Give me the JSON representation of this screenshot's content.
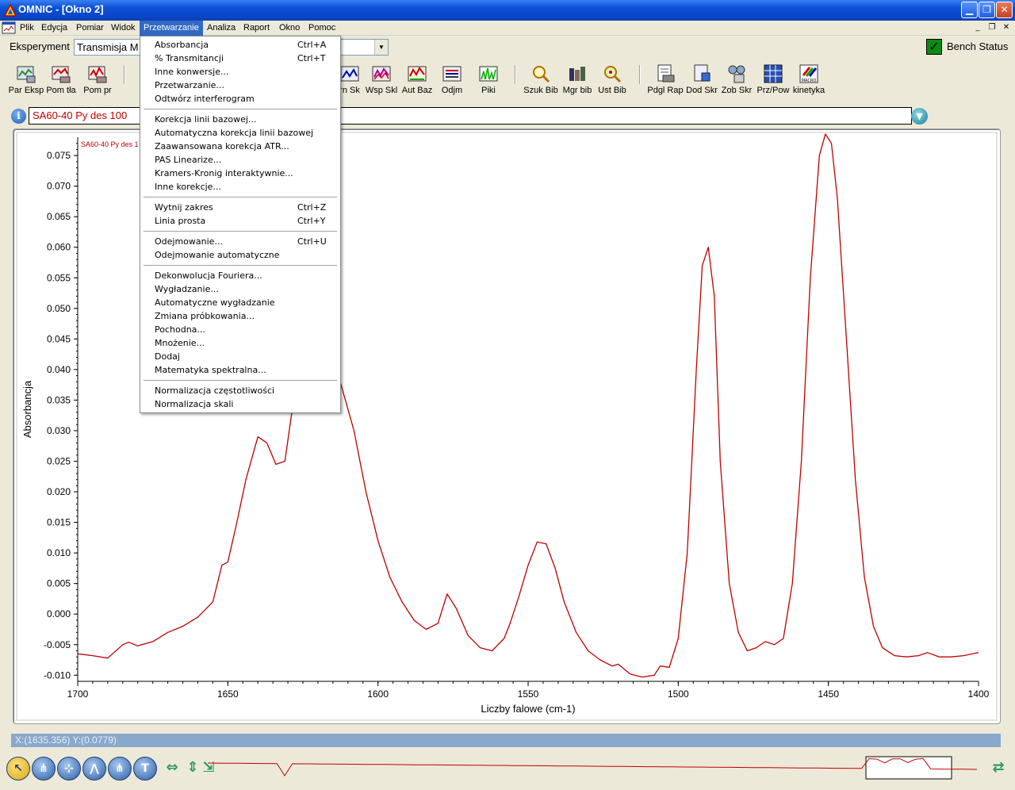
{
  "window": {
    "title": "OMNIC - [Okno 2]"
  },
  "menubar": {
    "items": [
      "Plik",
      "Edycja",
      "Pomiar",
      "Widok",
      "Przetwarzanie",
      "Analiza",
      "Raport",
      "Okno",
      "Pomoc"
    ],
    "active": "Przetwarzanie"
  },
  "experiment": {
    "label": "Eksperyment",
    "value": "Transmisja M"
  },
  "bench_status": {
    "label": "Bench Status"
  },
  "toolbar": {
    "items": [
      "Par Eksp",
      "Pom tła",
      "Pom pr",
      "rn Sk",
      "Wsp Skl",
      "Aut Baz",
      "Odjm",
      "Piki",
      "Szuk Bib",
      "Mgr bib",
      "Ust Bib",
      "Pdgl Rap",
      "Dod Skr",
      "Zob Skr",
      "Prz/Pow",
      "kinetyka"
    ],
    "macro_label": "MACRO"
  },
  "spectrum": {
    "title": "SA60-40 Py des 100",
    "inset_label": "SA60-40 Py des 1"
  },
  "dropdown": {
    "items": [
      {
        "label": "Absorbancja",
        "shortcut": "Ctrl+A"
      },
      {
        "label": "% Transmitancji",
        "shortcut": "Ctrl+T"
      },
      {
        "label": "Inne konwersje...",
        "shortcut": ""
      },
      {
        "label": "Przetwarzanie...",
        "shortcut": ""
      },
      {
        "label": "Odtwórz interferogram",
        "shortcut": ""
      },
      {
        "label": "Korekcja linii bazowej...",
        "shortcut": ""
      },
      {
        "label": "Automatyczna korekcja linii bazowej",
        "shortcut": ""
      },
      {
        "label": "Zaawansowana korekcja ATR...",
        "shortcut": ""
      },
      {
        "label": "PAS Linearize...",
        "shortcut": ""
      },
      {
        "label": "Kramers-Kronig interaktywnie...",
        "shortcut": ""
      },
      {
        "label": "Inne korekcje...",
        "shortcut": ""
      },
      {
        "label": "Wytnij zakres",
        "shortcut": "Ctrl+Z"
      },
      {
        "label": "Linia prosta",
        "shortcut": "Ctrl+Y"
      },
      {
        "label": "Odejmowanie...",
        "shortcut": "Ctrl+U"
      },
      {
        "label": "Odejmowanie automatyczne",
        "shortcut": ""
      },
      {
        "label": "Dekonwolucja Fouriera...",
        "shortcut": ""
      },
      {
        "label": "Wygładzanie...",
        "shortcut": ""
      },
      {
        "label": "Automatyczne wygładzanie",
        "shortcut": ""
      },
      {
        "label": "Zmiana próbkowania...",
        "shortcut": ""
      },
      {
        "label": "Pochodna...",
        "shortcut": ""
      },
      {
        "label": "Mnożenie...",
        "shortcut": ""
      },
      {
        "label": "Dodaj",
        "shortcut": ""
      },
      {
        "label": "Matematyka spektralna...",
        "shortcut": ""
      },
      {
        "label": "Normalizacja częstotliwości",
        "shortcut": ""
      },
      {
        "label": "Normalizacja skali",
        "shortcut": ""
      }
    ]
  },
  "status": {
    "coords": "X:(1635.356) Y:(0.0779)"
  },
  "chart_data": {
    "type": "line",
    "xlabel": "Liczby falowe (cm-1)",
    "ylabel": "Absorbancja",
    "xlim": [
      1700,
      1400
    ],
    "ylim": [
      -0.011,
      0.078
    ],
    "x_ticks": [
      "1700",
      "1650",
      "1600",
      "1550",
      "1500",
      "1450",
      "1400"
    ],
    "y_ticks": [
      "0.075",
      "0.070",
      "0.065",
      "0.060",
      "0.055",
      "0.050",
      "0.045",
      "0.040",
      "0.035",
      "0.030",
      "0.025",
      "0.020",
      "0.015",
      "0.010",
      "0.005",
      "0.000",
      "-0.005",
      "-0.010"
    ],
    "series": [
      {
        "color": "#c00000",
        "x": [
          1700,
          1695,
          1690,
          1685,
          1683,
          1680,
          1675,
          1670,
          1665,
          1660,
          1655,
          1652,
          1650,
          1647,
          1644,
          1640,
          1637,
          1634,
          1631,
          1629,
          1627,
          1625,
          1622,
          1618,
          1615,
          1612,
          1608,
          1604,
          1600,
          1596,
          1592,
          1588,
          1584,
          1580,
          1577,
          1574,
          1570,
          1566,
          1562,
          1558,
          1556,
          1553,
          1550,
          1547,
          1544,
          1541,
          1538,
          1534,
          1530,
          1526,
          1522,
          1520,
          1516,
          1512,
          1508,
          1506,
          1503,
          1500,
          1497,
          1494,
          1492,
          1490,
          1488,
          1486,
          1483,
          1480,
          1477,
          1474,
          1471,
          1468,
          1465,
          1462,
          1459,
          1456,
          1453,
          1451,
          1449,
          1447,
          1444,
          1441,
          1438,
          1435,
          1432,
          1428,
          1424,
          1420,
          1417,
          1413,
          1409,
          1405,
          1400
        ],
        "y": [
          -0.0065,
          -0.0068,
          -0.0072,
          -0.005,
          -0.0046,
          -0.0052,
          -0.0045,
          -0.003,
          -0.002,
          -0.0005,
          0.002,
          0.008,
          0.0085,
          0.015,
          0.022,
          0.029,
          0.028,
          0.0245,
          0.025,
          0.032,
          0.038,
          0.042,
          0.045,
          0.044,
          0.042,
          0.037,
          0.03,
          0.02,
          0.012,
          0.006,
          0.002,
          -0.001,
          -0.0025,
          -0.0015,
          0.0033,
          0.001,
          -0.0035,
          -0.0055,
          -0.006,
          -0.004,
          -0.0015,
          0.003,
          0.008,
          0.0118,
          0.0115,
          0.0075,
          0.002,
          -0.003,
          -0.006,
          -0.0075,
          -0.0085,
          -0.0082,
          -0.0098,
          -0.0103,
          -0.01,
          -0.0085,
          -0.0087,
          -0.004,
          0.01,
          0.04,
          0.057,
          0.06,
          0.052,
          0.025,
          0.005,
          -0.003,
          -0.006,
          -0.0055,
          -0.0045,
          -0.005,
          -0.004,
          0.005,
          0.025,
          0.055,
          0.075,
          0.0785,
          0.077,
          0.068,
          0.045,
          0.022,
          0.006,
          -0.002,
          -0.0055,
          -0.0068,
          -0.007,
          -0.0068,
          -0.0063,
          -0.007,
          -0.007,
          -0.0068,
          -0.0063
        ]
      }
    ]
  },
  "overview": {
    "label": "overview-strip"
  }
}
